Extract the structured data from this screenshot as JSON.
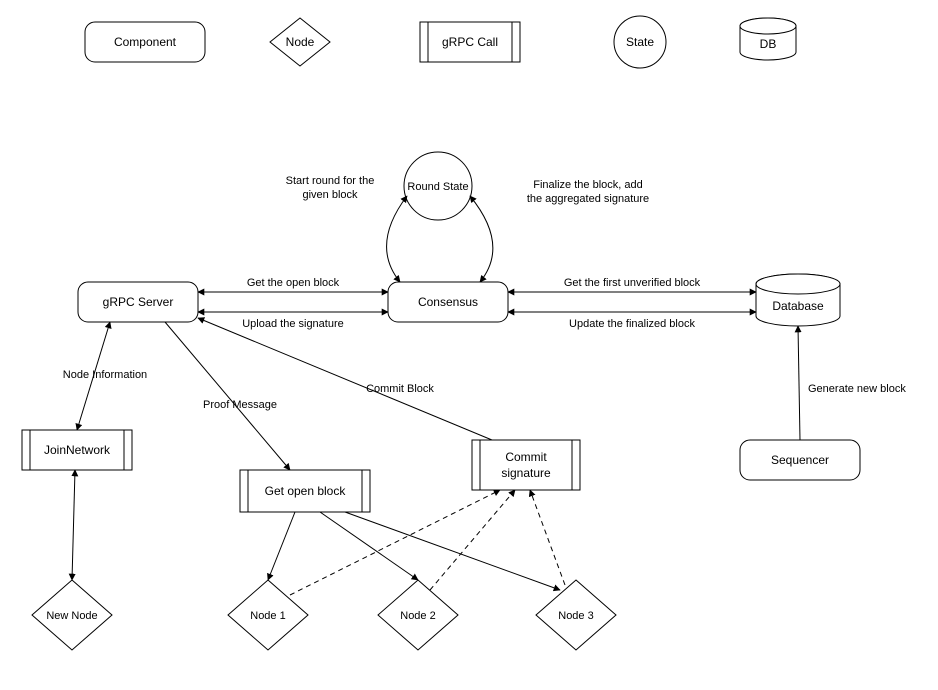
{
  "legend": {
    "component": "Component",
    "node": "Node",
    "grpc": "gRPC Call",
    "state": "State",
    "db": "DB"
  },
  "nodes": {
    "round_state": "Round State",
    "grpc_server": "gRPC Server",
    "consensus": "Consensus",
    "database": "Database",
    "join_network": "JoinNetwork",
    "get_open_block": "Get open block",
    "commit_signature_l1": "Commit",
    "commit_signature_l2": "signature",
    "sequencer": "Sequencer",
    "new_node": "New Node",
    "node1": "Node 1",
    "node2": "Node 2",
    "node3": "Node 3"
  },
  "edges": {
    "start_round_l1": "Start round for the",
    "start_round_l2": "given block",
    "finalize_l1": "Finalize the block, add",
    "finalize_l2": "the aggregated signature",
    "get_open_block": "Get the open block",
    "upload_signature": "Upload the signature",
    "get_first_unverified": "Get the first unverified block",
    "update_finalized": "Update the finalized block",
    "node_information": "Node Information",
    "proof_message": "Proof Message",
    "commit_block": "Commit Block",
    "generate_new_block": "Generate new block"
  }
}
